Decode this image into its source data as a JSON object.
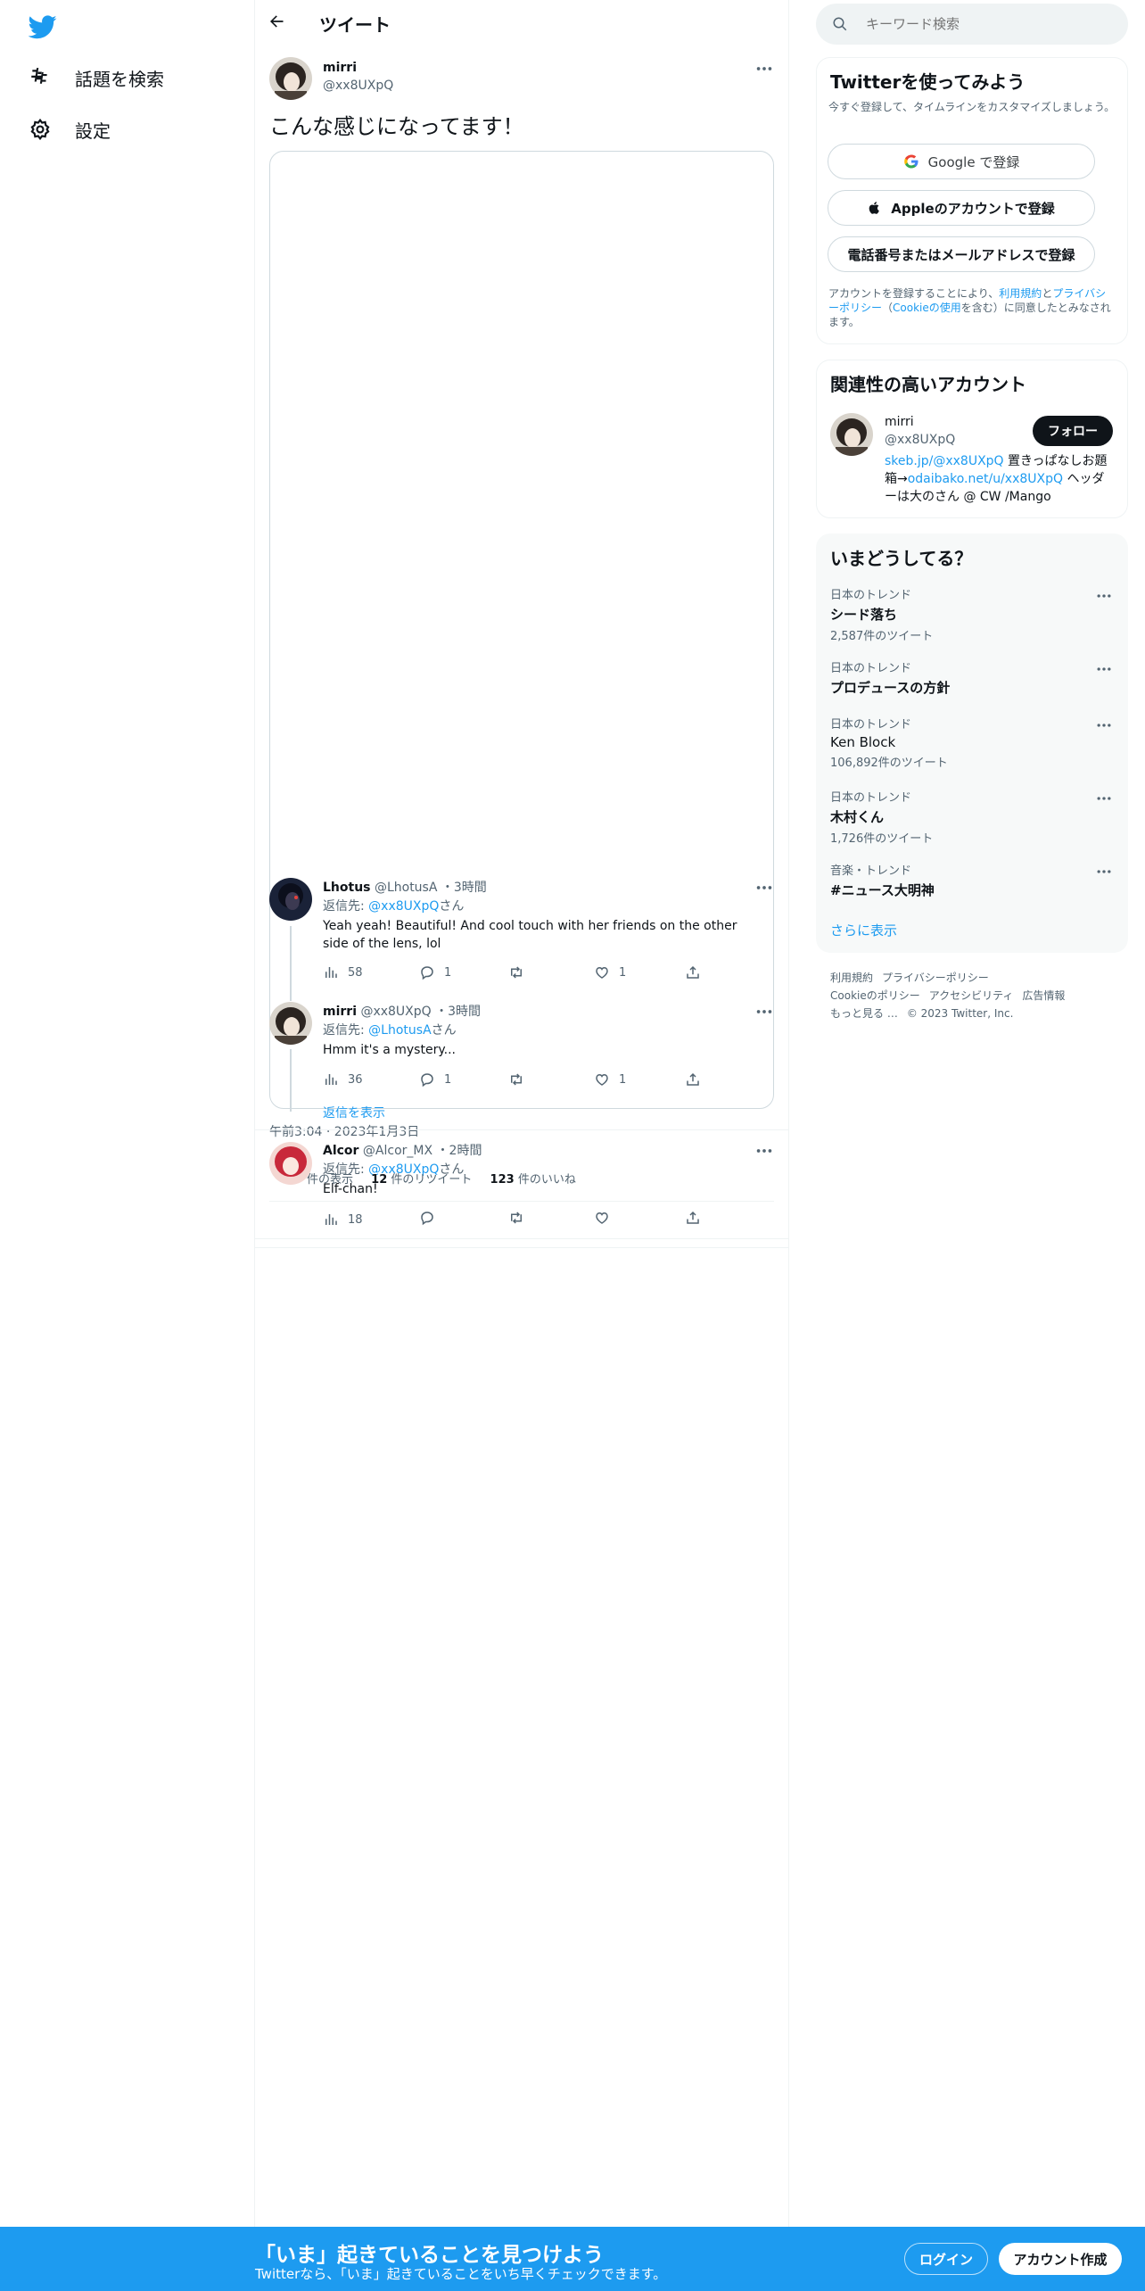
{
  "nav": {
    "explore": "話題を検索",
    "settings": "設定"
  },
  "header": {
    "title": "ツイート"
  },
  "tweet": {
    "name": "mirri",
    "handle": "@xx8UXpQ",
    "text": "こんな感じになってます！",
    "timestamp": "午前3:04 · 2023年1月3日",
    "views_label": "件の表示",
    "retweets_count": "12",
    "retweets_label": "件のリツイート",
    "likes_count": "123",
    "likes_label": "件のいいね"
  },
  "replies": [
    {
      "name": "Lhotus",
      "handle": "@LhotusA",
      "time": "・3時間",
      "reply_prefix": "返信先: ",
      "reply_to": "@xx8UXpQ",
      "reply_suffix": "さん",
      "text": "Yeah yeah! Beautiful! And cool touch with her friends on the other side of the lens, lol",
      "views": "58",
      "replies": "1",
      "likes": "1"
    },
    {
      "name": "mirri",
      "handle": "@xx8UXpQ",
      "time": "・3時間",
      "reply_prefix": "返信先: ",
      "reply_to": "@LhotusA",
      "reply_suffix": "さん",
      "text": "Hmm it's a mystery...",
      "views": "36",
      "replies": "1",
      "likes": "1"
    },
    {
      "name": "Alcor",
      "handle": "@Alcor_MX",
      "time": "・2時間",
      "reply_prefix": "返信先: ",
      "reply_to": "@xx8UXpQ",
      "reply_suffix": "さん",
      "text": "Elf-chan!",
      "views": "18"
    }
  ],
  "show_replies": "返信を表示",
  "search": {
    "placeholder": "キーワード検索"
  },
  "signup": {
    "title": "Twitterを使ってみよう",
    "subtitle": "今すぐ登録して、タイムラインをカスタマイズしましょう。",
    "google": "Google で登録",
    "apple": "Appleのアカウントで登録",
    "phone": "電話番号またはメールアドレスで登録",
    "terms_1": "アカウントを登録することにより、",
    "terms_link1": "利用規約",
    "terms_2": "と",
    "terms_link2": "プライバシーポリシー",
    "terms_3": "（",
    "terms_link3": "Cookieの使用",
    "terms_4": "を含む）に同意したとみなされます。"
  },
  "related": {
    "title": "関連性の高いアカウント",
    "name": "mirri",
    "handle": "@xx8UXpQ",
    "follow": "フォロー",
    "bio_link1": "skeb.jp/@xx8UXpQ",
    "bio_1": " 置きっぱなしお題箱→",
    "bio_link2": "odaibako.net/u/xx8UXpQ",
    "bio_2": " ヘッダーは大のさん @ CW /Mango"
  },
  "trends": {
    "title": "いまどうしてる？",
    "items": [
      {
        "label": "日本のトレンド",
        "name": "シード落ち",
        "count": "2,587件のツイート"
      },
      {
        "label": "日本のトレンド",
        "name": "プロデュースの方針",
        "count": ""
      },
      {
        "label": "日本のトレンド",
        "name": "Ken Block",
        "count": "106,892件のツイート"
      },
      {
        "label": "日本のトレンド",
        "name": "木村くん",
        "count": "1,726件のツイート"
      },
      {
        "label": "音楽・トレンド",
        "name": "#ニュース大明神",
        "count": ""
      }
    ],
    "show_more": "さらに表示"
  },
  "footer": {
    "terms": "利用規約",
    "privacy": "プライバシーポリシー",
    "cookie": "Cookieのポリシー",
    "accessibility": "アクセシビリティ",
    "ads": "広告情報",
    "more": "もっと見る …",
    "copyright": "© 2023 Twitter, Inc."
  },
  "bottom_bar": {
    "title": "「いま」起きていることを見つけよう",
    "subtitle": "Twitterなら、「いま」起きていることをいち早くチェックできます。",
    "login": "ログイン",
    "signup": "アカウント作成"
  },
  "colors": {
    "accent": "#1d9bf0",
    "dark": "#0f1419",
    "muted": "#536471"
  },
  "icons": [
    "twitter-logo-icon",
    "hashtag-icon",
    "gear-icon",
    "back-arrow-icon",
    "more-icon",
    "views-icon",
    "reply-icon",
    "retweet-icon",
    "like-icon",
    "share-icon",
    "search-icon",
    "google-icon",
    "apple-icon"
  ]
}
